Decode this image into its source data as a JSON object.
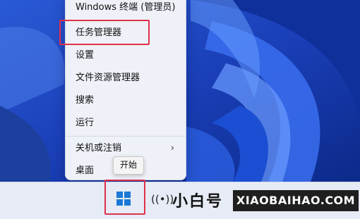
{
  "context_menu": {
    "items": [
      {
        "label": "Windows 终端 (管理员)",
        "has_submenu": false
      },
      {
        "label": "任务管理器",
        "has_submenu": false
      },
      {
        "label": "设置",
        "has_submenu": false
      },
      {
        "label": "文件资源管理器",
        "has_submenu": false
      },
      {
        "label": "搜索",
        "has_submenu": false
      },
      {
        "label": "运行",
        "has_submenu": false
      },
      {
        "label": "关机或注销",
        "has_submenu": true
      },
      {
        "label": "桌面",
        "has_submenu": false
      }
    ],
    "highlighted_item": "任务管理器",
    "highlight_color": "#e0314b"
  },
  "tooltip": {
    "text": "开始"
  },
  "taskbar": {
    "start_button_icon": "windows-logo-icon"
  },
  "watermark": {
    "chinese": "小白号",
    "domain": "XIAOBAIHAO.COM",
    "icon": "radio-waves-icon"
  },
  "colors": {
    "wallpaper_blue": "#1b52d8",
    "accent": "#1a78d6"
  }
}
